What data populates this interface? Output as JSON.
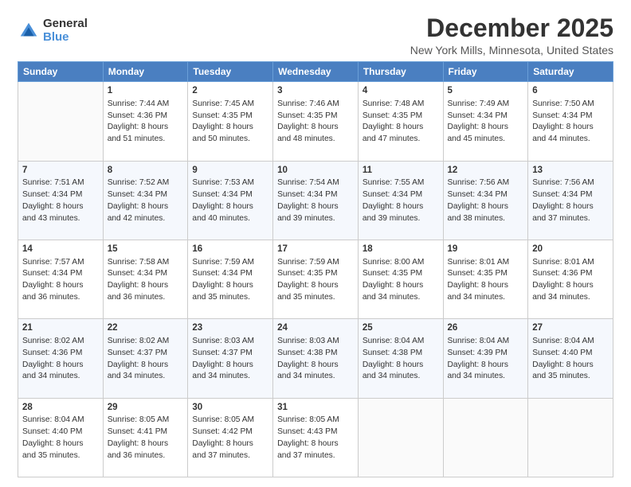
{
  "logo": {
    "general": "General",
    "blue": "Blue"
  },
  "title": "December 2025",
  "location": "New York Mills, Minnesota, United States",
  "weekdays": [
    "Sunday",
    "Monday",
    "Tuesday",
    "Wednesday",
    "Thursday",
    "Friday",
    "Saturday"
  ],
  "weeks": [
    [
      {
        "day": "",
        "sunrise": "",
        "sunset": "",
        "daylight": ""
      },
      {
        "day": "1",
        "sunrise": "Sunrise: 7:44 AM",
        "sunset": "Sunset: 4:36 PM",
        "daylight": "Daylight: 8 hours and 51 minutes."
      },
      {
        "day": "2",
        "sunrise": "Sunrise: 7:45 AM",
        "sunset": "Sunset: 4:35 PM",
        "daylight": "Daylight: 8 hours and 50 minutes."
      },
      {
        "day": "3",
        "sunrise": "Sunrise: 7:46 AM",
        "sunset": "Sunset: 4:35 PM",
        "daylight": "Daylight: 8 hours and 48 minutes."
      },
      {
        "day": "4",
        "sunrise": "Sunrise: 7:48 AM",
        "sunset": "Sunset: 4:35 PM",
        "daylight": "Daylight: 8 hours and 47 minutes."
      },
      {
        "day": "5",
        "sunrise": "Sunrise: 7:49 AM",
        "sunset": "Sunset: 4:34 PM",
        "daylight": "Daylight: 8 hours and 45 minutes."
      },
      {
        "day": "6",
        "sunrise": "Sunrise: 7:50 AM",
        "sunset": "Sunset: 4:34 PM",
        "daylight": "Daylight: 8 hours and 44 minutes."
      }
    ],
    [
      {
        "day": "7",
        "sunrise": "Sunrise: 7:51 AM",
        "sunset": "Sunset: 4:34 PM",
        "daylight": "Daylight: 8 hours and 43 minutes."
      },
      {
        "day": "8",
        "sunrise": "Sunrise: 7:52 AM",
        "sunset": "Sunset: 4:34 PM",
        "daylight": "Daylight: 8 hours and 42 minutes."
      },
      {
        "day": "9",
        "sunrise": "Sunrise: 7:53 AM",
        "sunset": "Sunset: 4:34 PM",
        "daylight": "Daylight: 8 hours and 40 minutes."
      },
      {
        "day": "10",
        "sunrise": "Sunrise: 7:54 AM",
        "sunset": "Sunset: 4:34 PM",
        "daylight": "Daylight: 8 hours and 39 minutes."
      },
      {
        "day": "11",
        "sunrise": "Sunrise: 7:55 AM",
        "sunset": "Sunset: 4:34 PM",
        "daylight": "Daylight: 8 hours and 39 minutes."
      },
      {
        "day": "12",
        "sunrise": "Sunrise: 7:56 AM",
        "sunset": "Sunset: 4:34 PM",
        "daylight": "Daylight: 8 hours and 38 minutes."
      },
      {
        "day": "13",
        "sunrise": "Sunrise: 7:56 AM",
        "sunset": "Sunset: 4:34 PM",
        "daylight": "Daylight: 8 hours and 37 minutes."
      }
    ],
    [
      {
        "day": "14",
        "sunrise": "Sunrise: 7:57 AM",
        "sunset": "Sunset: 4:34 PM",
        "daylight": "Daylight: 8 hours and 36 minutes."
      },
      {
        "day": "15",
        "sunrise": "Sunrise: 7:58 AM",
        "sunset": "Sunset: 4:34 PM",
        "daylight": "Daylight: 8 hours and 36 minutes."
      },
      {
        "day": "16",
        "sunrise": "Sunrise: 7:59 AM",
        "sunset": "Sunset: 4:34 PM",
        "daylight": "Daylight: 8 hours and 35 minutes."
      },
      {
        "day": "17",
        "sunrise": "Sunrise: 7:59 AM",
        "sunset": "Sunset: 4:35 PM",
        "daylight": "Daylight: 8 hours and 35 minutes."
      },
      {
        "day": "18",
        "sunrise": "Sunrise: 8:00 AM",
        "sunset": "Sunset: 4:35 PM",
        "daylight": "Daylight: 8 hours and 34 minutes."
      },
      {
        "day": "19",
        "sunrise": "Sunrise: 8:01 AM",
        "sunset": "Sunset: 4:35 PM",
        "daylight": "Daylight: 8 hours and 34 minutes."
      },
      {
        "day": "20",
        "sunrise": "Sunrise: 8:01 AM",
        "sunset": "Sunset: 4:36 PM",
        "daylight": "Daylight: 8 hours and 34 minutes."
      }
    ],
    [
      {
        "day": "21",
        "sunrise": "Sunrise: 8:02 AM",
        "sunset": "Sunset: 4:36 PM",
        "daylight": "Daylight: 8 hours and 34 minutes."
      },
      {
        "day": "22",
        "sunrise": "Sunrise: 8:02 AM",
        "sunset": "Sunset: 4:37 PM",
        "daylight": "Daylight: 8 hours and 34 minutes."
      },
      {
        "day": "23",
        "sunrise": "Sunrise: 8:03 AM",
        "sunset": "Sunset: 4:37 PM",
        "daylight": "Daylight: 8 hours and 34 minutes."
      },
      {
        "day": "24",
        "sunrise": "Sunrise: 8:03 AM",
        "sunset": "Sunset: 4:38 PM",
        "daylight": "Daylight: 8 hours and 34 minutes."
      },
      {
        "day": "25",
        "sunrise": "Sunrise: 8:04 AM",
        "sunset": "Sunset: 4:38 PM",
        "daylight": "Daylight: 8 hours and 34 minutes."
      },
      {
        "day": "26",
        "sunrise": "Sunrise: 8:04 AM",
        "sunset": "Sunset: 4:39 PM",
        "daylight": "Daylight: 8 hours and 34 minutes."
      },
      {
        "day": "27",
        "sunrise": "Sunrise: 8:04 AM",
        "sunset": "Sunset: 4:40 PM",
        "daylight": "Daylight: 8 hours and 35 minutes."
      }
    ],
    [
      {
        "day": "28",
        "sunrise": "Sunrise: 8:04 AM",
        "sunset": "Sunset: 4:40 PM",
        "daylight": "Daylight: 8 hours and 35 minutes."
      },
      {
        "day": "29",
        "sunrise": "Sunrise: 8:05 AM",
        "sunset": "Sunset: 4:41 PM",
        "daylight": "Daylight: 8 hours and 36 minutes."
      },
      {
        "day": "30",
        "sunrise": "Sunrise: 8:05 AM",
        "sunset": "Sunset: 4:42 PM",
        "daylight": "Daylight: 8 hours and 37 minutes."
      },
      {
        "day": "31",
        "sunrise": "Sunrise: 8:05 AM",
        "sunset": "Sunset: 4:43 PM",
        "daylight": "Daylight: 8 hours and 37 minutes."
      },
      {
        "day": "",
        "sunrise": "",
        "sunset": "",
        "daylight": ""
      },
      {
        "day": "",
        "sunrise": "",
        "sunset": "",
        "daylight": ""
      },
      {
        "day": "",
        "sunrise": "",
        "sunset": "",
        "daylight": ""
      }
    ]
  ]
}
